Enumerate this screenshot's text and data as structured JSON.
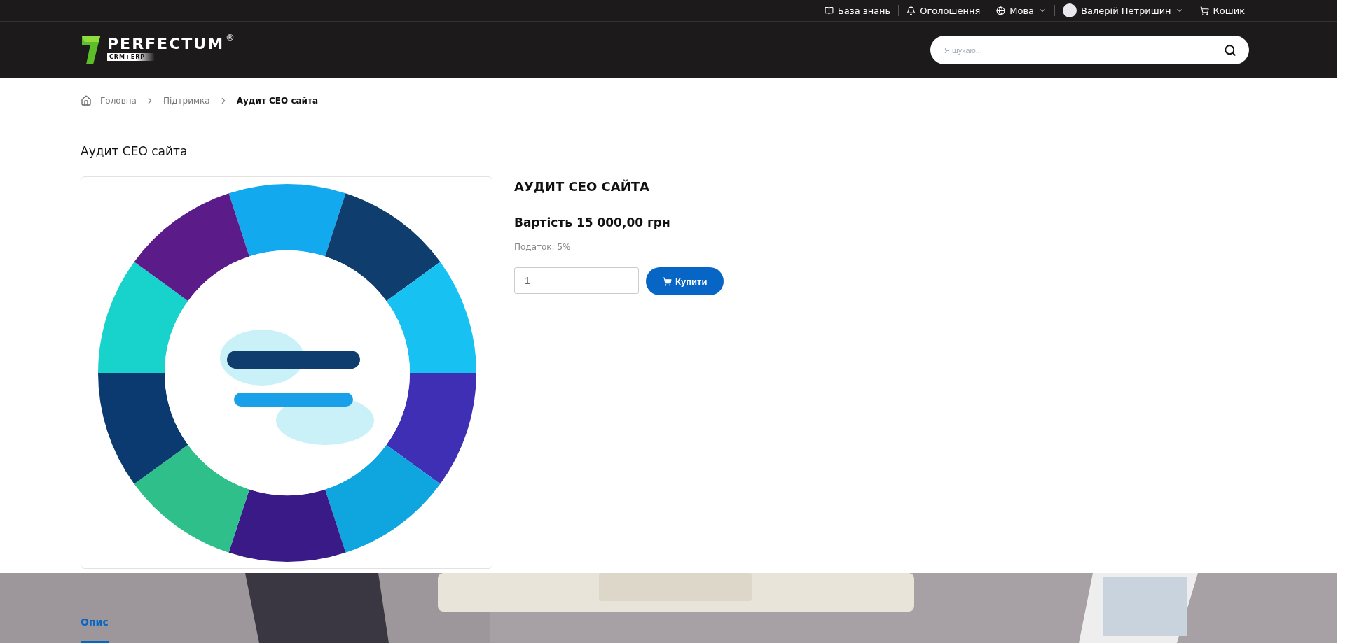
{
  "top_bar": {
    "links": [
      {
        "kind": "book",
        "label": "База знань"
      },
      {
        "kind": "bell",
        "label": "Оголошення"
      },
      {
        "kind": "globe",
        "label": "Мова",
        "caret": true
      },
      {
        "kind": "user",
        "label": "Валерій Петришин",
        "caret": true
      },
      {
        "kind": "cart",
        "label": "Кошик"
      }
    ]
  },
  "header": {
    "logo": {
      "name": "PERFECTUM",
      "mark": "®",
      "tagline": "CRM+ERP"
    },
    "search": {
      "placeholder": "Я шукаю..."
    }
  },
  "breadcrumbs": [
    {
      "label": "Головна",
      "current": false
    },
    {
      "label": "Підтримка",
      "current": false
    },
    {
      "label": "Аудит СЕО сайта",
      "current": true
    }
  ],
  "page_title": "Аудит СЕО сайта",
  "product": {
    "name": "АУДИТ СЕО САЙТА",
    "price": "Вартість 15 000,00 грн",
    "tax": "Податок: 5%",
    "quantity": "1",
    "buy_label": "Купити"
  },
  "tabs": [
    {
      "label": "Опис",
      "selected": true
    }
  ]
}
